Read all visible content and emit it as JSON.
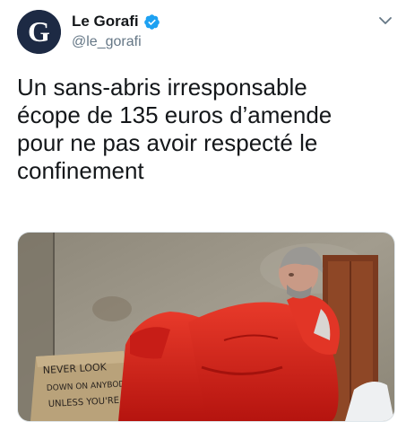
{
  "account": {
    "display_name": "Le Gorafi",
    "handle": "@le_gorafi",
    "avatar_letter": "G",
    "verified": true
  },
  "tweet": {
    "lines": [
      "Un sans-abris irresponsable",
      "écope de 135 euros d’amende",
      "pour ne pas avoir respecté le",
      "confinement"
    ]
  },
  "media": {
    "sign_lines": [
      "NEVER LOOK",
      "DOWN ON ANYBODY",
      "UNLESS YOU'RE"
    ]
  },
  "colors": {
    "verified_blue": "#1da1f2",
    "text": "#14171a",
    "secondary_text": "#657786",
    "sleeping_bag_red": "#d8251f"
  },
  "icons": {
    "menu": "chevron-down-icon",
    "verified": "verified-badge-icon"
  }
}
